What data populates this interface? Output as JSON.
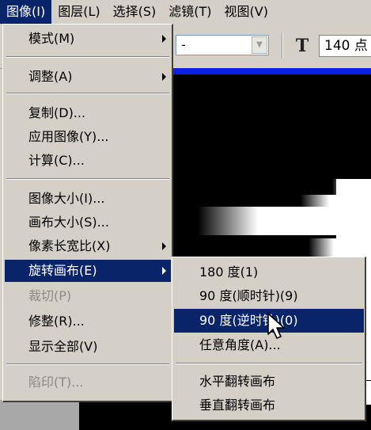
{
  "menubar": {
    "items": [
      {
        "label": "图像(I)",
        "active": true
      },
      {
        "label": "图层(L)",
        "active": false
      },
      {
        "label": "选择(S)",
        "active": false
      },
      {
        "label": "滤镜(T)",
        "active": false
      },
      {
        "label": "视图(V)",
        "active": false
      }
    ]
  },
  "toolbar": {
    "combo_value": "-",
    "type_icon": "text-tool-icon",
    "type_icon_glyph": "T",
    "font_size": "140 点"
  },
  "image_menu": {
    "items": [
      {
        "label": "模式(M)",
        "submenu": true
      },
      {
        "label": "调整(A)",
        "submenu": true
      },
      {
        "label": "复制(D)..."
      },
      {
        "label": "应用图像(Y)..."
      },
      {
        "label": "计算(C)..."
      },
      {
        "label": "图像大小(I)..."
      },
      {
        "label": "画布大小(S)..."
      },
      {
        "label": "像素长宽比(X)",
        "submenu": true
      },
      {
        "label": "旋转画布(E)",
        "submenu": true,
        "highlighted": true
      },
      {
        "label": "裁切(P)",
        "disabled": true
      },
      {
        "label": "修整(R)..."
      },
      {
        "label": "显示全部(V)"
      },
      {
        "label": "陷印(T)...",
        "disabled": true
      }
    ]
  },
  "rotate_submenu": {
    "items": [
      {
        "label": "180 度(1)"
      },
      {
        "label": "90 度(顺时针)(9)"
      },
      {
        "label": "90 度(逆时针)(0)",
        "highlighted": true
      },
      {
        "label": "任意角度(A)..."
      },
      {
        "label": "水平翻转画布"
      },
      {
        "label": "垂直翻转画布"
      }
    ]
  },
  "colors": {
    "highlight": "#0a246a",
    "menu_bg": "#d4d0c8",
    "disabled_text": "#8c8a84"
  }
}
